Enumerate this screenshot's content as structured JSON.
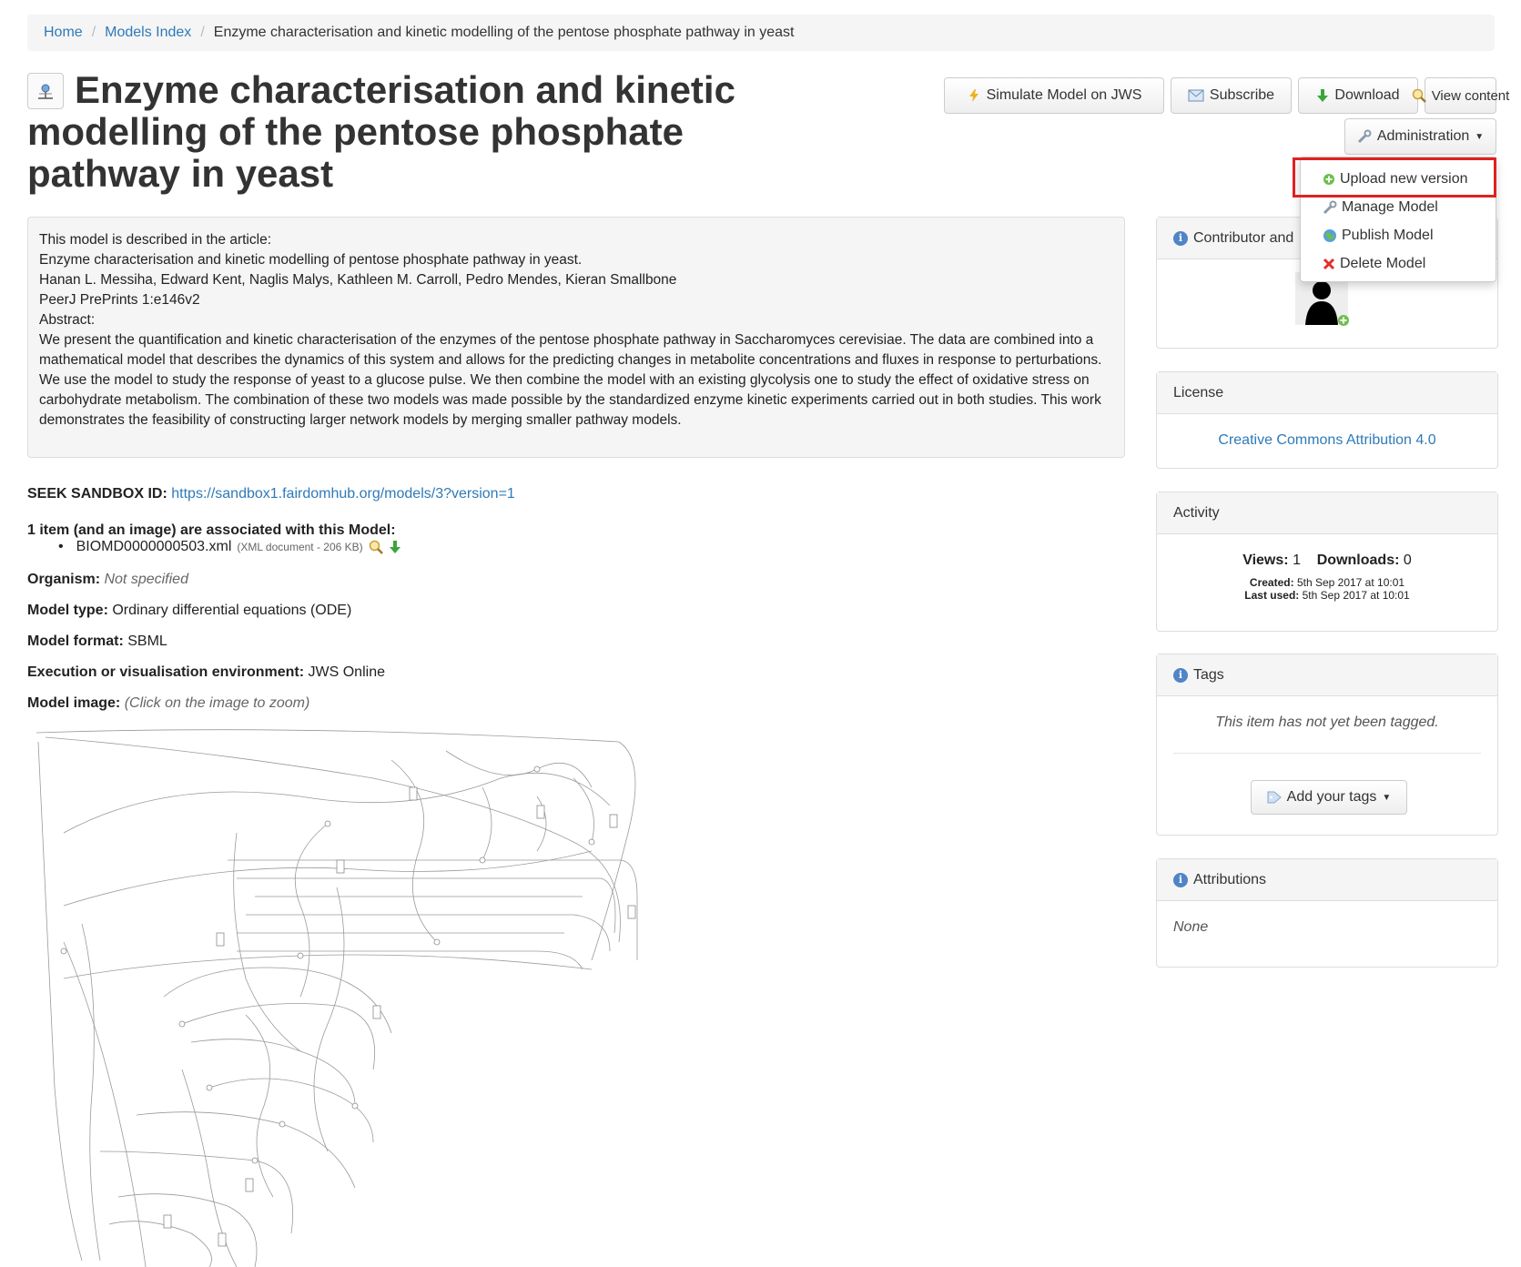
{
  "breadcrumb": {
    "home": "Home",
    "models_index": "Models Index",
    "current": "Enzyme characterisation and kinetic modelling of the pentose phosphate pathway in yeast"
  },
  "title": "Enzyme characterisation and kinetic modelling of the pentose phosphate pathway in yeast",
  "toolbar": {
    "simulate": "Simulate Model on JWS",
    "subscribe": "Subscribe",
    "download": "Download",
    "view_content": "View content",
    "administration": "Administration"
  },
  "admin_menu": {
    "upload": "Upload new version",
    "manage": "Manage Model",
    "publish": "Publish Model",
    "delete": "Delete Model"
  },
  "description": {
    "line1": "This model is described in the article:",
    "line2": "Enzyme characterisation and kinetic modelling of pentose phosphate pathway in yeast.",
    "line3": "Hanan L. Messiha, Edward Kent, Naglis Malys, Kathleen M. Carroll, Pedro Mendes, Kieran Smallbone",
    "line4": "PeerJ PrePrints 1:e146v2",
    "line5": "Abstract:",
    "abstract": "We present the quantification and kinetic characterisation of the enzymes of the pentose phosphate pathway in Saccharomyces cerevisiae. The data are combined into a mathematical model that describes the dynamics of this system and allows for the predicting changes in metabolite concentrations and fluxes in response to perturbations. We use the model to study the response of yeast to a glucose pulse. We then combine the model with an existing glycolysis one to study the effect of oxidative stress on carbohydrate metabolism. The combination of these two models was made possible by the standardized enzyme kinetic experiments carried out in both studies. This work demonstrates the feasibility of constructing larger network models by merging smaller pathway models."
  },
  "meta": {
    "seek_label": "SEEK SANDBOX ID:",
    "seek_url": "https://sandbox1.fairdomhub.org/models/3?version=1",
    "assoc_heading": "1 item (and an image) are associated with this Model:",
    "file_name": "BIOMD0000000503.xml",
    "file_info": "(XML document - 206 KB)",
    "organism_label": "Organism:",
    "organism_value": "Not specified",
    "model_type_label": "Model type:",
    "model_type_value": "Ordinary differential equations (ODE)",
    "model_format_label": "Model format:",
    "model_format_value": "SBML",
    "exec_env_label": "Execution or visualisation environment:",
    "exec_env_value": "JWS Online",
    "model_image_label": "Model image:",
    "model_image_hint": "(Click on the image to zoom)"
  },
  "panels": {
    "contributor_heading": "Contributor and",
    "license_heading": "License",
    "license_value": "Creative Commons Attribution 4.0",
    "activity_heading": "Activity",
    "views_label": "Views:",
    "views_value": "1",
    "downloads_label": "Downloads:",
    "downloads_value": "0",
    "created_label": "Created:",
    "created_value": "5th Sep 2017 at 10:01",
    "last_used_label": "Last used:",
    "last_used_value": "5th Sep 2017 at 10:01",
    "tags_heading": "Tags",
    "tags_empty": "This item has not yet been tagged.",
    "add_tags": "Add your tags",
    "attributions_heading": "Attributions",
    "attributions_value": "None"
  },
  "colors": {
    "link": "#2f7ab8",
    "highlight": "#e02020",
    "delete_icon": "#e0302a",
    "download_icon": "#3aa63a"
  }
}
